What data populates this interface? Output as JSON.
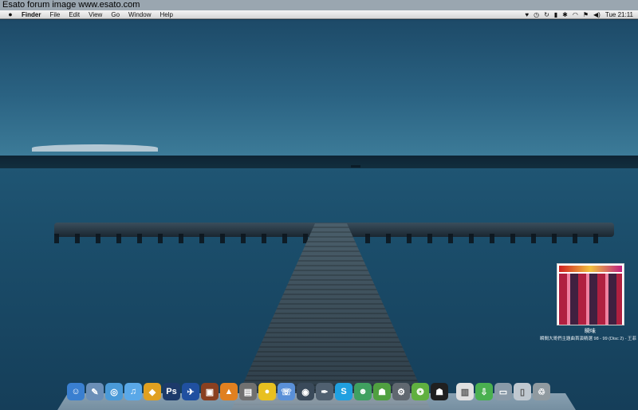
{
  "watermark": {
    "text": "Esato forum image www.esato.com"
  },
  "menubar": {
    "apple": "",
    "menus": [
      "Finder",
      "File",
      "Edit",
      "View",
      "Go",
      "Window",
      "Help"
    ],
    "clock": "Tue 21:11"
  },
  "album": {
    "title": "瞬味",
    "subtitle": "瞬間大哥們主題曲首演精選 98 - 99 (Disc 2) - 王菲"
  },
  "dock": {
    "items": [
      {
        "name": "finder-icon",
        "color": "#3a7fd0",
        "glyph": "☺"
      },
      {
        "name": "preview-icon",
        "color": "#6b8fb8",
        "glyph": "✎"
      },
      {
        "name": "safari-icon",
        "color": "#4a9ad8",
        "glyph": "◎"
      },
      {
        "name": "itunes-icon",
        "color": "#5aa8e8",
        "glyph": "♫"
      },
      {
        "name": "transmit-icon",
        "color": "#e0a020",
        "glyph": "◆"
      },
      {
        "name": "photoshop-icon",
        "color": "#1c3a6a",
        "glyph": "Ps"
      },
      {
        "name": "bird-icon",
        "color": "#2050a0",
        "glyph": "✈"
      },
      {
        "name": "video-icon",
        "color": "#8a4020",
        "glyph": "▣"
      },
      {
        "name": "vlc-icon",
        "color": "#e08020",
        "glyph": "▲"
      },
      {
        "name": "photo-icon",
        "color": "#707070",
        "glyph": "▤"
      },
      {
        "name": "adium-icon",
        "color": "#e8c020",
        "glyph": "●"
      },
      {
        "name": "ichat-icon",
        "color": "#5a90d8",
        "glyph": "☏"
      },
      {
        "name": "quicktime-icon",
        "color": "#3a4a5a",
        "glyph": "◉"
      },
      {
        "name": "pen-icon",
        "color": "#506070",
        "glyph": "✒"
      },
      {
        "name": "skype-icon",
        "color": "#20a0e0",
        "glyph": "S"
      },
      {
        "name": "messenger-icon",
        "color": "#40a060",
        "glyph": "☻"
      },
      {
        "name": "android-icon",
        "color": "#50a040",
        "glyph": "☗"
      },
      {
        "name": "utility-icon",
        "color": "#606870",
        "glyph": "⚙"
      },
      {
        "name": "spiral-icon",
        "color": "#60b040",
        "glyph": "❂"
      },
      {
        "name": "agent-icon",
        "color": "#202020",
        "glyph": "☗"
      },
      {
        "name": "document-icon",
        "color": "#e0e0e0",
        "glyph": "▥"
      },
      {
        "name": "downloads-icon",
        "color": "#4ab050",
        "glyph": "⇩"
      },
      {
        "name": "folder-icon",
        "color": "#8a9aa8",
        "glyph": "▭"
      },
      {
        "name": "file-icon",
        "color": "#c0c8d0",
        "glyph": "▯"
      },
      {
        "name": "trash-icon",
        "color": "#909aa0",
        "glyph": "♲"
      }
    ]
  }
}
